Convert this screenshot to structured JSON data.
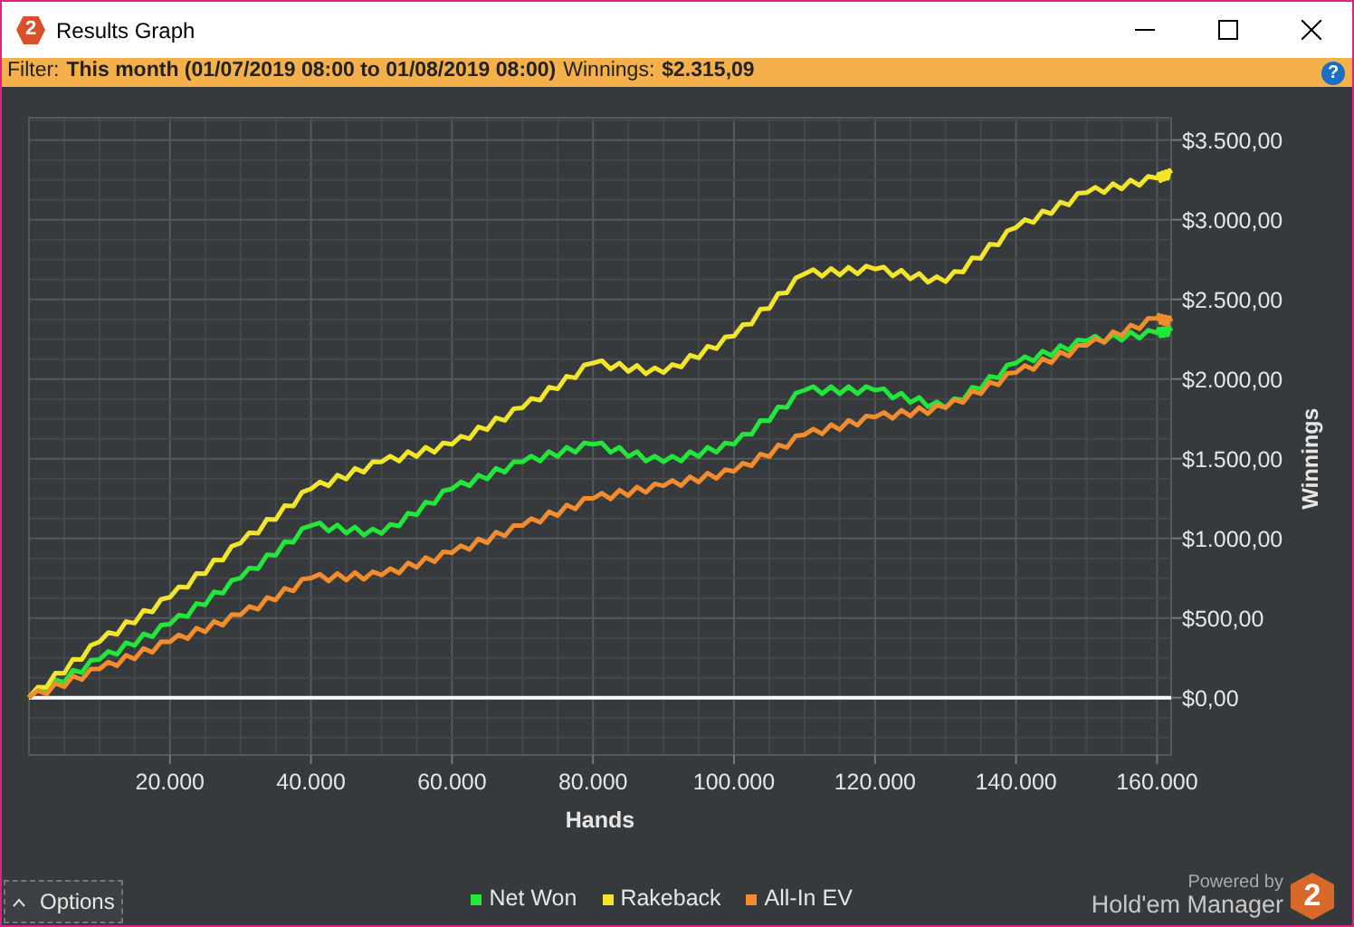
{
  "window": {
    "title": "Results Graph",
    "logo": "2"
  },
  "filter_bar": {
    "filter_label": "Filter:",
    "filter_value": "This month (01/07/2019 08:00 to 01/08/2019 08:00)",
    "winnings_label": "Winnings:",
    "winnings_value": "$2.315,09",
    "help": "?"
  },
  "chart": {
    "chart_data": {
      "type": "line",
      "xlabel": "Hands",
      "ylabel": "Winnings",
      "x": [
        0,
        10000,
        20000,
        30000,
        40000,
        50000,
        60000,
        70000,
        80000,
        90000,
        100000,
        110000,
        120000,
        130000,
        140000,
        150000,
        160000,
        162000
      ],
      "series": [
        {
          "name": "Net Won",
          "color": "#22e63a",
          "values": [
            0,
            240,
            460,
            750,
            1080,
            1030,
            1310,
            1480,
            1590,
            1480,
            1590,
            1930,
            1930,
            1820,
            2100,
            2240,
            2290,
            2300
          ]
        },
        {
          "name": "Rakeback",
          "color": "#f2e52c",
          "values": [
            0,
            350,
            630,
            970,
            1310,
            1480,
            1590,
            1820,
            2100,
            2040,
            2270,
            2660,
            2690,
            2610,
            2950,
            3170,
            3260,
            3290
          ]
        },
        {
          "name": "All-In EV",
          "color": "#f28c2c",
          "values": [
            0,
            180,
            350,
            520,
            750,
            770,
            910,
            1080,
            1250,
            1330,
            1420,
            1650,
            1760,
            1820,
            2040,
            2210,
            2380,
            2360
          ]
        }
      ],
      "grid": true,
      "xlim": [
        0,
        162000
      ],
      "ylim": [
        -360,
        3640
      ],
      "xticks": [
        {
          "value": 20000,
          "label": "20.000"
        },
        {
          "value": 40000,
          "label": "40.000"
        },
        {
          "value": 60000,
          "label": "60.000"
        },
        {
          "value": 80000,
          "label": "80.000"
        },
        {
          "value": 100000,
          "label": "100.000"
        },
        {
          "value": 120000,
          "label": "120.000"
        },
        {
          "value": 140000,
          "label": "140.000"
        },
        {
          "value": 160000,
          "label": "160.000"
        }
      ],
      "yticks": [
        {
          "value": 0,
          "label": "$0,00"
        },
        {
          "value": 500,
          "label": "$500,00"
        },
        {
          "value": 1000,
          "label": "$1.000,00"
        },
        {
          "value": 1500,
          "label": "$1.500,00"
        },
        {
          "value": 2000,
          "label": "$2.000,00"
        },
        {
          "value": 2500,
          "label": "$2.500,00"
        },
        {
          "value": 3000,
          "label": "$3.000,00"
        },
        {
          "value": 3500,
          "label": "$3.500,00"
        }
      ]
    }
  },
  "footer": {
    "options_button": "Options",
    "powered_by": "Powered by",
    "product": "Hold'em Manager",
    "product_logo": "2"
  }
}
